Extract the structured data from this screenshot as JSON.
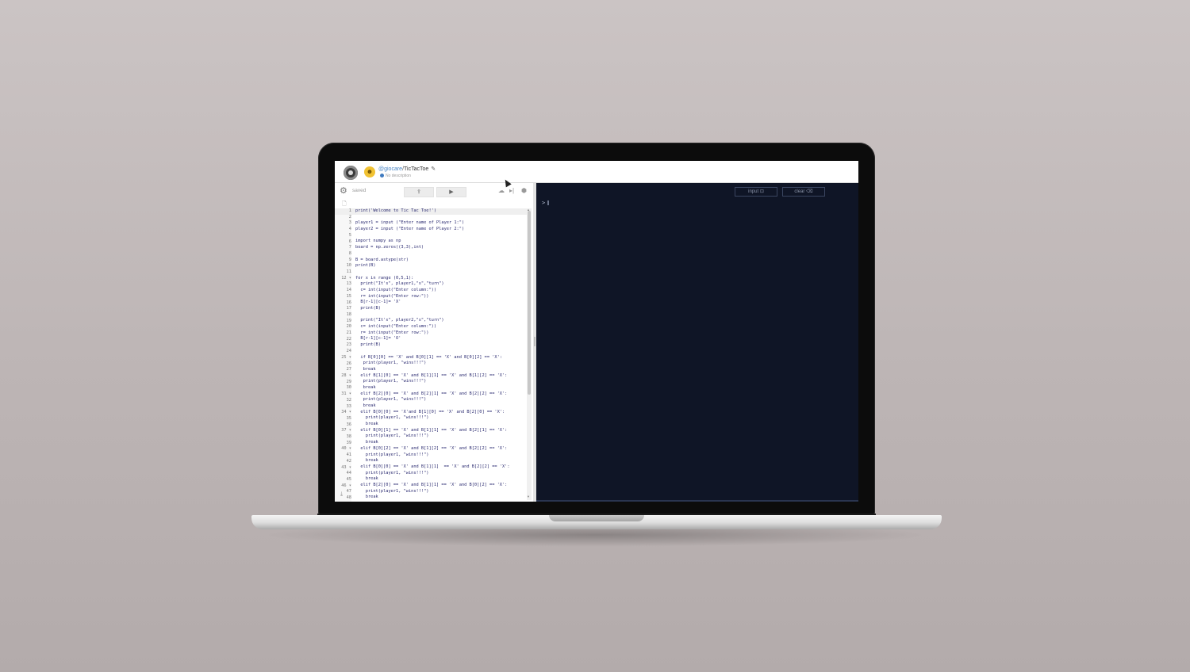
{
  "header": {
    "username": "@giocare",
    "separator": "/",
    "repl_name": "TicTacToe",
    "description": "No description"
  },
  "editor": {
    "status": "saved",
    "line_numbers": [
      "1",
      "2",
      "3",
      "4",
      "5",
      "6",
      "7",
      "8",
      "9",
      "10",
      "11",
      "12 ▾",
      "13",
      "14",
      "15",
      "16",
      "17",
      "18",
      "19",
      "20",
      "21",
      "22",
      "23",
      "24",
      "25 ▾",
      "26",
      "27",
      "28 ▾",
      "29",
      "30",
      "31 ▾",
      "32",
      "33",
      "34 ▾",
      "35",
      "36",
      "37 ▾",
      "38",
      "39",
      "40 ▾",
      "41",
      "42",
      "43 ▾",
      "44",
      "45",
      "46 ▾",
      "47",
      "48"
    ],
    "code": [
      "print('Welcome to Tic Tac Toe!')",
      "",
      "player1 = input (\"Enter name of Player 1:\")",
      "player2 = input (\"Enter name of Player 2:\")",
      "",
      "import numpy as np",
      "board = np.zeros((3,3),int)",
      "",
      "B = board.astype(str)",
      "print(B)",
      "",
      "for x in range (0,5,1):",
      "  print(\"It's\", player1,\"s\",\"turn\")",
      "  c= int(input(\"Enter column:\"))",
      "  r= int(input(\"Enter row:\"))",
      "  B[r-1][c-1]= 'X'",
      "  print(B)",
      "",
      "  print(\"It's\", player2,\"s\",\"turn\")",
      "  c= int(input(\"Enter column:\"))",
      "  r= int(input(\"Enter row:\"))",
      "  B[r-1][c-1]= 'O'",
      "  print(B)",
      "",
      "  if B[0][0] == 'X' and B[0][1] == 'X' and B[0][2] == 'X':",
      "   print(player1, \"wins!!!\")",
      "   break",
      "  elif B[1][0] == 'X' and B[1][1] == 'X' and B[1][2] == 'X':",
      "   print(player1, \"wins!!!\")",
      "   break",
      "  elif B[2][0] == 'X' and B[2][1] == 'X' and B[2][2] == 'X':",
      "   print(player1, \"wins!!!\")",
      "   break",
      "  elif B[0][0] == 'X'and B[1][0] == 'X' and B[2][0] == 'X':",
      "    print(player1, \"wins!!!\")",
      "    break",
      "  elif B[0][1] == 'X' and B[1][1] == 'X' and B[2][1] == 'X':",
      "    print(player1, \"wins!!!\")",
      "    break",
      "  elif B[0][2] == 'X' and B[1][2] == 'X' and B[2][2] == 'X':",
      "    print(player1, \"wins!!!\")",
      "    break",
      "  elif B[0][0] == 'X' and B[1][1]  == 'X' and B[2][2] == 'X':",
      "    print(player1, \"wins!!!\")",
      "    break",
      "  elif B[2][0] == 'X' and B[1][1] == 'X' and B[0][2] == 'X':",
      "    print(player1, \"wins!!!\")",
      "    break"
    ]
  },
  "console": {
    "input_label": "input ⊡",
    "clear_label": "clear ⌫",
    "prompt": ">"
  },
  "icons": {
    "gear": "⚙",
    "share": "⇪",
    "run": "▶",
    "cloud": "☁",
    "step": "▸|",
    "package": "⬢",
    "file": "🗋",
    "download": "⤓",
    "edit": "✎"
  },
  "colors": {
    "console_bg": "#0f1526",
    "link_blue": "#4a86c5",
    "avatar_yellow": "#f1c232"
  }
}
